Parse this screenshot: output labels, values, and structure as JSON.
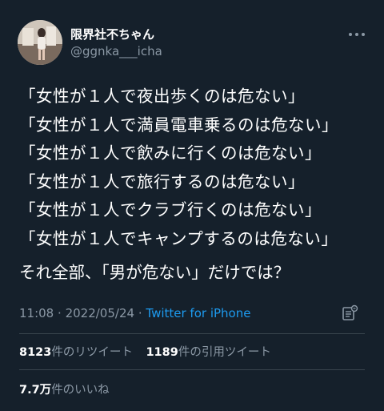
{
  "author": {
    "display_name": "限界社不ちゃん",
    "handle": "@ggnka___icha"
  },
  "tweet": {
    "lines": [
      "「女性が１人で夜出歩くのは危ない」",
      "「女性が１人で満員電車乗るのは危ない」",
      "「女性が１人で飲みに行くのは危ない」",
      "「女性が１人で旅行するのは危ない」",
      "「女性が１人でクラブ行くのは危ない」",
      "「女性が１人でキャンプするのは危ない」"
    ],
    "closing": "それ全部、「男が危ない」だけでは？"
  },
  "meta": {
    "time": "11:08",
    "date": "2022/05/24",
    "separator": "·",
    "source": "Twitter for iPhone"
  },
  "stats": {
    "retweets_count": "8123",
    "retweets_label": "件のリツイート",
    "quotes_count": "1189",
    "quotes_label": "件の引用ツイート",
    "likes_count": "7.7万",
    "likes_label": "件のいいね"
  },
  "icons": {
    "more": "more-horizontal-icon",
    "analytics": "analytics-icon"
  },
  "colors": {
    "background": "#15202b",
    "text": "#ffffff",
    "secondary": "#8b98a5",
    "link": "#1d9bf0",
    "divider": "#38444d"
  }
}
